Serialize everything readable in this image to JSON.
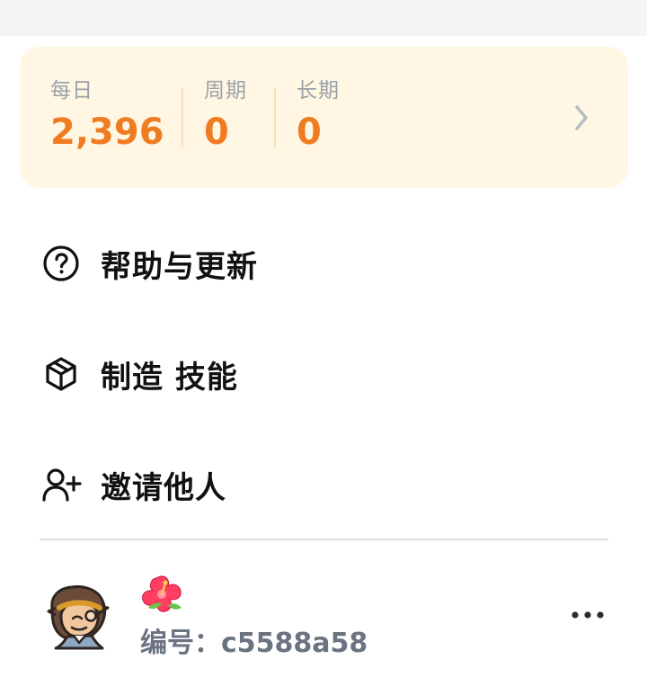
{
  "credits": {
    "daily": {
      "label": "每日",
      "value": "2,396"
    },
    "weekly": {
      "label": "周期",
      "value": "0"
    },
    "long_term": {
      "label": "长期",
      "value": "0"
    },
    "accent_color": "#f07c22",
    "card_color": "#fff7e3",
    "arrow_icon": "chevron-right-icon"
  },
  "menu": {
    "items": [
      {
        "icon": "help-circle-icon",
        "label": "帮助与更新"
      },
      {
        "icon": "package-cube-icon",
        "label": "制造 技能"
      },
      {
        "icon": "user-plus-icon",
        "label": "邀请他人"
      }
    ]
  },
  "profile": {
    "avatar_icon": "cartoon-monkey-avatar",
    "emoji_icon": "hibiscus-flower-icon",
    "id_text": "编号：c5588a58",
    "more_icon": "more-horizontal-icon"
  }
}
